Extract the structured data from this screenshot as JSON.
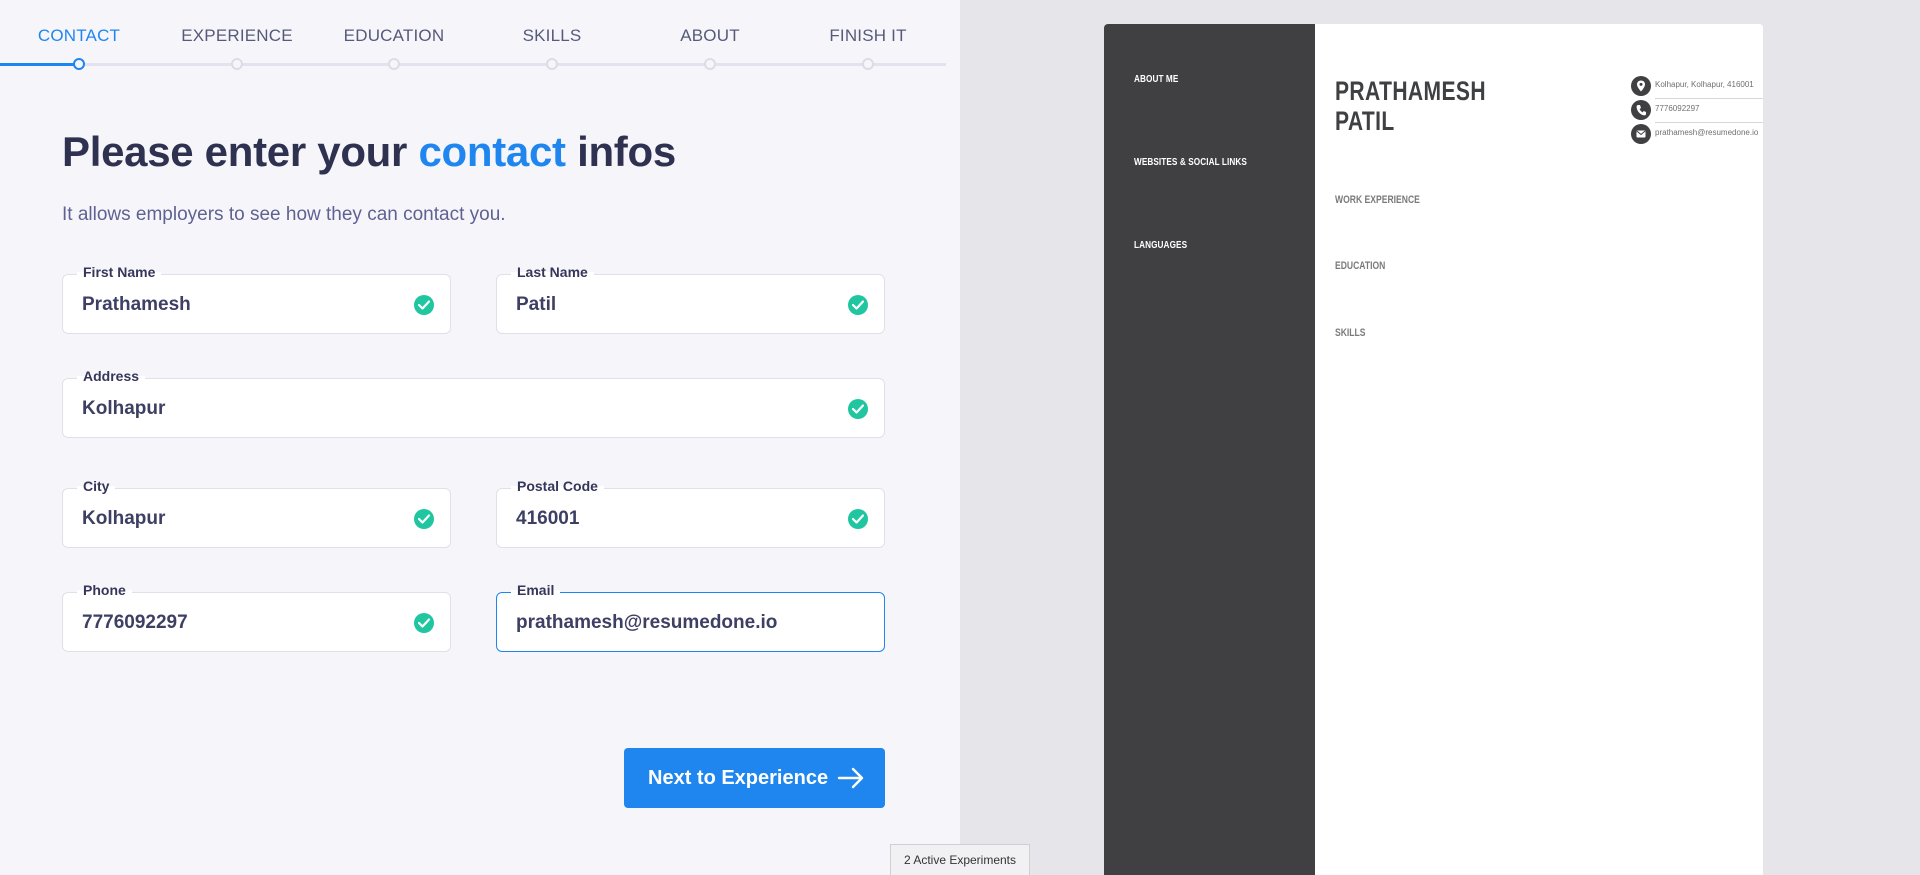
{
  "steps": [
    {
      "label": "CONTACT",
      "active": true
    },
    {
      "label": "EXPERIENCE",
      "active": false
    },
    {
      "label": "EDUCATION",
      "active": false
    },
    {
      "label": "SKILLS",
      "active": false
    },
    {
      "label": "ABOUT",
      "active": false
    },
    {
      "label": "FINISH IT",
      "active": false
    }
  ],
  "heading": {
    "prefix": "Please enter your ",
    "highlight": "contact",
    "suffix": " infos"
  },
  "subtitle": "It allows employers to see how they can contact you.",
  "form": {
    "first_name": {
      "label": "First Name",
      "value": "Prathamesh",
      "valid": true
    },
    "last_name": {
      "label": "Last Name",
      "value": "Patil",
      "valid": true
    },
    "address": {
      "label": "Address",
      "value": "Kolhapur",
      "valid": true
    },
    "city": {
      "label": "City",
      "value": "Kolhapur",
      "valid": true
    },
    "postal_code": {
      "label": "Postal Code",
      "value": "416001",
      "valid": true
    },
    "phone": {
      "label": "Phone",
      "value": "7776092297",
      "valid": true
    },
    "email": {
      "label": "Email",
      "value": "prathamesh@resumedone.io",
      "valid": false,
      "focused": true
    }
  },
  "next_button": {
    "label": "Next to Experience",
    "icon": "arrow-right-icon"
  },
  "colors": {
    "accent": "#1f86f0",
    "valid": "#20c6a0",
    "resume_sidebar": "#404042"
  },
  "resume": {
    "sidebar_sections": [
      "ABOUT ME",
      "WEBSITES & SOCIAL LINKS",
      "LANGUAGES"
    ],
    "name_line1": "PRATHAMESH",
    "name_line2": "PATIL",
    "contact": [
      {
        "icon": "location-pin-icon",
        "text": "Kolhapur, Kolhapur, 416001"
      },
      {
        "icon": "phone-icon",
        "text": "7776092297"
      },
      {
        "icon": "mail-icon",
        "text": "prathamesh@resumedone.io"
      }
    ],
    "main_sections": [
      "WORK EXPERIENCE",
      "EDUCATION",
      "SKILLS"
    ]
  },
  "experiments_badge": "2 Active Experiments"
}
